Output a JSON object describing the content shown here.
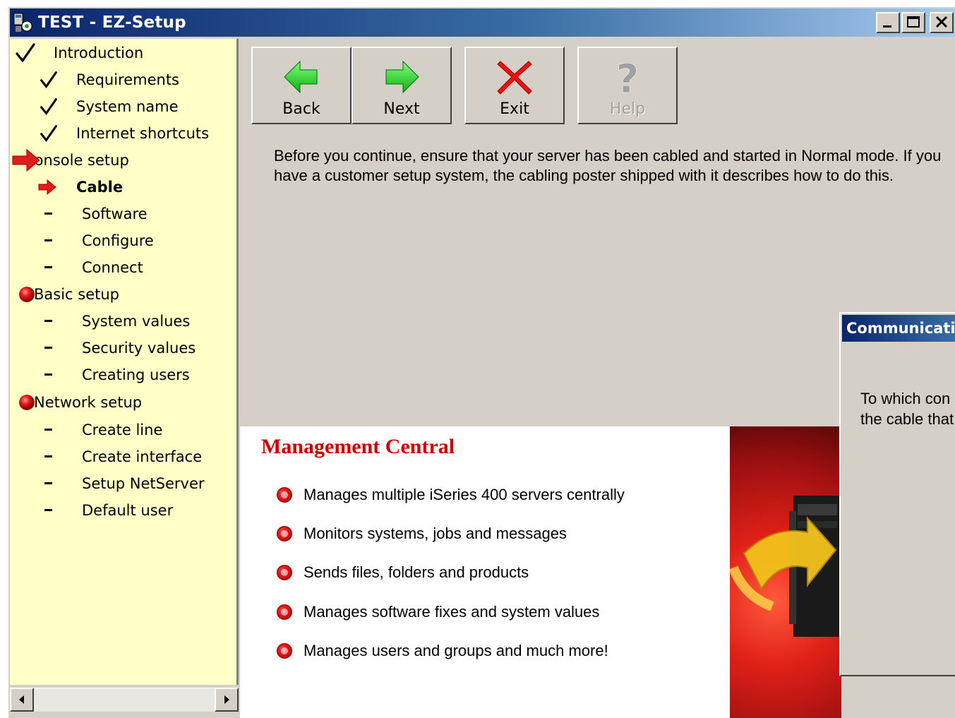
{
  "window": {
    "title": "TEST - EZ-Setup"
  },
  "colors": {
    "titlebar_start": "#0a246a",
    "titlebar_end": "#a6caf0",
    "sidebar_bg": "#ffffc8",
    "arrow_red": "#e41b1b",
    "banner_title": "#cc0000",
    "nav_arrow_green": "#22cc22"
  },
  "sidebar": {
    "items": [
      {
        "label": "Introduction",
        "level": 0,
        "status": "done",
        "icon": "checkmark-icon"
      },
      {
        "label": "Requirements",
        "level": 1,
        "status": "done",
        "icon": "checkmark-icon"
      },
      {
        "label": "System name",
        "level": 1,
        "status": "done",
        "icon": "checkmark-icon"
      },
      {
        "label": "Internet shortcuts",
        "level": 1,
        "status": "done",
        "icon": "checkmark-icon"
      },
      {
        "label": "Console setup",
        "level": 0,
        "status": "current",
        "icon": "red-arrow-icon"
      },
      {
        "label": "Cable",
        "level": 1,
        "status": "current",
        "icon": "red-arrow-icon"
      },
      {
        "label": "Software",
        "level": 1,
        "status": "pending",
        "icon": "dash-icon"
      },
      {
        "label": "Configure",
        "level": 1,
        "status": "pending",
        "icon": "dash-icon"
      },
      {
        "label": "Connect",
        "level": 1,
        "status": "pending",
        "icon": "dash-icon"
      },
      {
        "label": "Basic setup",
        "level": 0,
        "status": "todo",
        "icon": "red-dot-icon"
      },
      {
        "label": "System values",
        "level": 1,
        "status": "pending",
        "icon": "dash-icon"
      },
      {
        "label": "Security values",
        "level": 1,
        "status": "pending",
        "icon": "dash-icon"
      },
      {
        "label": "Creating users",
        "level": 1,
        "status": "pending",
        "icon": "dash-icon"
      },
      {
        "label": "Network setup",
        "level": 0,
        "status": "todo",
        "icon": "red-dot-icon"
      },
      {
        "label": "Create line",
        "level": 1,
        "status": "pending",
        "icon": "dash-icon"
      },
      {
        "label": "Create interface",
        "level": 1,
        "status": "pending",
        "icon": "dash-icon"
      },
      {
        "label": "Setup NetServer",
        "level": 1,
        "status": "pending",
        "icon": "dash-icon"
      },
      {
        "label": "Default user",
        "level": 1,
        "status": "pending",
        "icon": "dash-icon"
      }
    ]
  },
  "toolbar": {
    "back_label": "Back",
    "next_label": "Next",
    "exit_label": "Exit",
    "help_label": "Help"
  },
  "main": {
    "instructions": "Before you continue, ensure that your server has been cabled and started in Normal mode.  If you have a customer setup system, the cabling poster shipped with it describes how to do this."
  },
  "banner": {
    "title": "Management Central",
    "bullets": [
      "Manages multiple iSeries 400 servers centrally",
      "Monitors systems, jobs and messages",
      "Sends files, folders and products",
      "Manages software fixes and system values",
      "Manages users and groups and much more!"
    ]
  },
  "dialog": {
    "title": "Communicati",
    "text_line1": "To which con",
    "text_line2": "the cable that"
  }
}
